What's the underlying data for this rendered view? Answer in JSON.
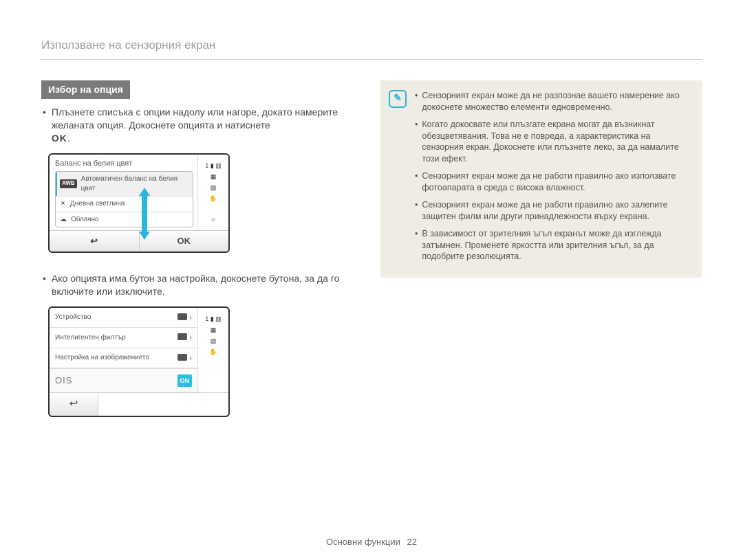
{
  "header": "Използване на сензорния екран",
  "section_title": "Избор на опция",
  "bullet1": "Плъзнете списъка с опции надолу или нагоре, докато намерите желаната опция. Докоснете опцията и натиснете",
  "ok_label": "OK",
  "lcd1": {
    "title": "Баланс на белия цвят",
    "status_num": "1",
    "row_awb_badge": "AWB",
    "row_awb": "Автоматичен баланс на белия цвят",
    "row_daylight": "Дневна светлина",
    "row_cloudy": "Облачно",
    "back_glyph": "↩",
    "ok": "OK",
    "sun_icon": "☀",
    "cloud_icon": "☁",
    "bright_icon": "☼"
  },
  "bullet2": "Ако опцията има бутон за настройка, докоснете бутона, за да го включите или изключите.",
  "lcd2": {
    "status_num": "1",
    "row_device": "Устройство",
    "row_filter": "Интелигентен филтър",
    "row_image": "Настройка на изображението",
    "ois": "OIS",
    "on": "ON",
    "back_glyph": "↩",
    "chev": "›"
  },
  "notes": [
    "Сензорният екран може да не разпознае вашето намерение ако докоснете множество елементи едновременно.",
    "Когато докосвате или плъзгате екрана могат да възникнат обезцветявания. Това не е повреда, а характеристика на сензорния екран. Докоснете или плъзнете леко, за да намалите този ефект.",
    "Сензорният екран може да не работи правилно ако използвате фотоапарата в среда с висока влажност.",
    "Сензорният екран може да не работи правилно ако залепите защитен филм или други принадлежности върху екрана.",
    "В зависимост от зрителния ъгъл екранът може да изглежда затъмнен. Променете яркостта или зрителния ъгъл, за да подобрите резолюцията."
  ],
  "footer_label": "Основни функции",
  "footer_page": "22"
}
